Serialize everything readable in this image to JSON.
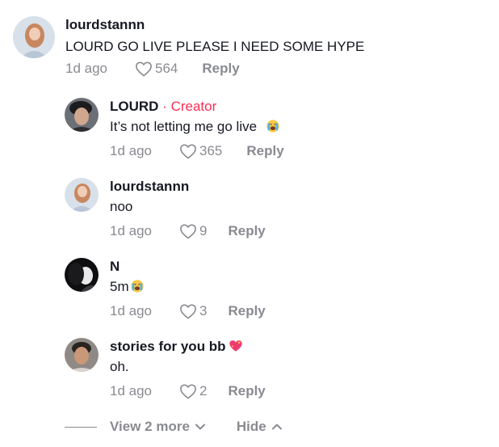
{
  "comments": [
    {
      "username": "lourdstannn",
      "text": "LOURD GO LIVE PLEASE I NEED SOME HYPE",
      "time": "1d ago",
      "likes": "564",
      "reply_label": "Reply"
    },
    {
      "username": "LOURD",
      "creator_label": "Creator",
      "text": "It’s not letting me go live",
      "emoji": "crying-face-emoji",
      "time": "1d ago",
      "likes": "365",
      "reply_label": "Reply"
    },
    {
      "username": "lourdstannn",
      "text": "noo",
      "time": "1d ago",
      "likes": "9",
      "reply_label": "Reply"
    },
    {
      "username": "N",
      "text": "5m",
      "emoji": "crying-face-emoji",
      "time": "1d ago",
      "likes": "3",
      "reply_label": "Reply"
    },
    {
      "username": "stories for you bb",
      "username_emoji": "sparkling-heart-emoji",
      "text": "oh.",
      "time": "1d ago",
      "likes": "2",
      "reply_label": "Reply"
    }
  ],
  "footer": {
    "view_more_label": "View 2 more",
    "hide_label": "Hide"
  },
  "colors": {
    "creator_accent": "#fe2c55",
    "muted_text": "#8a8b91",
    "primary_text": "#161823"
  }
}
